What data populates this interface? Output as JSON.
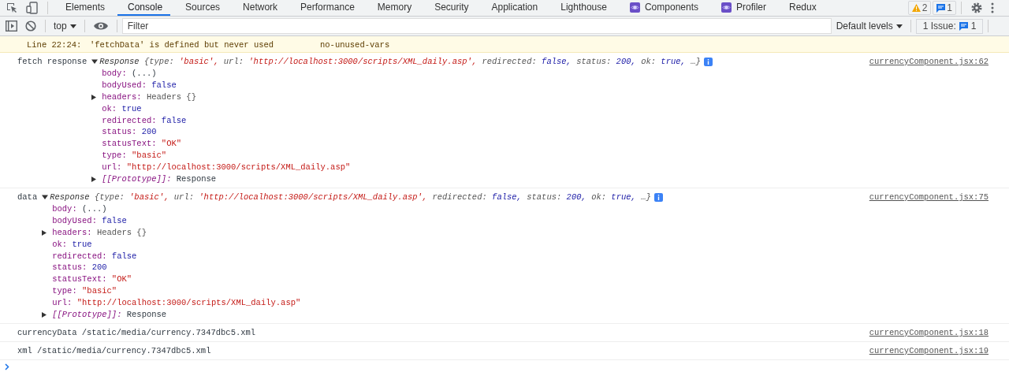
{
  "tabs": [
    {
      "label": "Elements",
      "selected": false,
      "kind": "plain"
    },
    {
      "label": "Console",
      "selected": true,
      "kind": "plain"
    },
    {
      "label": "Sources",
      "selected": false,
      "kind": "plain"
    },
    {
      "label": "Network",
      "selected": false,
      "kind": "plain"
    },
    {
      "label": "Performance",
      "selected": false,
      "kind": "plain"
    },
    {
      "label": "Memory",
      "selected": false,
      "kind": "plain"
    },
    {
      "label": "Security",
      "selected": false,
      "kind": "plain"
    },
    {
      "label": "Application",
      "selected": false,
      "kind": "plain"
    },
    {
      "label": "Lighthouse",
      "selected": false,
      "kind": "plain"
    },
    {
      "label": "Components",
      "selected": false,
      "kind": "react"
    },
    {
      "label": "Profiler",
      "selected": false,
      "kind": "react"
    },
    {
      "label": "Redux",
      "selected": false,
      "kind": "plain"
    }
  ],
  "counters": {
    "warnings": "2",
    "messages": "1"
  },
  "toolbar": {
    "context": "top",
    "filter_placeholder": "Filter",
    "levels": "Default levels",
    "issues_label": "1 Issue:",
    "issues_count": "1"
  },
  "warnings": [
    {
      "location": "Line 22:24:",
      "message": "'fetchData' is defined but never used",
      "rule": "no-unused-vars"
    }
  ],
  "messages": [
    {
      "label": "fetch response",
      "kind": "object",
      "expanded": true,
      "class_name": "Response",
      "open": "{",
      "close": "…}",
      "source": "currencyComponent.jsx:62",
      "preview": [
        {
          "key": "type:",
          "value": "'basic',",
          "kind": "string"
        },
        {
          "key": "url:",
          "value": "'http://localhost:3000/scripts/XML_daily.asp',",
          "kind": "string"
        },
        {
          "key": "redirected:",
          "value": "false,",
          "kind": "keyword"
        },
        {
          "key": "status:",
          "value": "200,",
          "kind": "keyword"
        },
        {
          "key": "ok:",
          "value": "true,",
          "kind": "keyword"
        }
      ],
      "properties": [
        {
          "name": "body:",
          "value": "(...)",
          "kind": "plain",
          "internal": false,
          "expandable": false
        },
        {
          "name": "bodyUsed:",
          "value": "false",
          "kind": "keyword",
          "internal": false,
          "expandable": false
        },
        {
          "name": "headers:",
          "value": "Headers {}",
          "kind": "object",
          "internal": false,
          "expandable": true
        },
        {
          "name": "ok:",
          "value": "true",
          "kind": "keyword",
          "internal": false,
          "expandable": false
        },
        {
          "name": "redirected:",
          "value": "false",
          "kind": "keyword",
          "internal": false,
          "expandable": false
        },
        {
          "name": "status:",
          "value": "200",
          "kind": "keyword",
          "internal": false,
          "expandable": false
        },
        {
          "name": "statusText:",
          "value": "\"OK\"",
          "kind": "string",
          "internal": false,
          "expandable": false
        },
        {
          "name": "type:",
          "value": "\"basic\"",
          "kind": "string",
          "internal": false,
          "expandable": false
        },
        {
          "name": "url:",
          "value": "\"http://localhost:3000/scripts/XML_daily.asp\"",
          "kind": "string",
          "internal": false,
          "expandable": false
        },
        {
          "name": "[[Prototype]]:",
          "value": "Response",
          "kind": "plain",
          "internal": true,
          "expandable": true
        }
      ]
    },
    {
      "label": "data",
      "kind": "object",
      "expanded": true,
      "class_name": "Response",
      "open": "{",
      "close": "…}",
      "source": "currencyComponent.jsx:75",
      "preview": [
        {
          "key": "type:",
          "value": "'basic',",
          "kind": "string"
        },
        {
          "key": "url:",
          "value": "'http://localhost:3000/scripts/XML_daily.asp',",
          "kind": "string"
        },
        {
          "key": "redirected:",
          "value": "false,",
          "kind": "keyword"
        },
        {
          "key": "status:",
          "value": "200,",
          "kind": "keyword"
        },
        {
          "key": "ok:",
          "value": "true,",
          "kind": "keyword"
        }
      ],
      "properties": [
        {
          "name": "body:",
          "value": "(...)",
          "kind": "plain",
          "internal": false,
          "expandable": false
        },
        {
          "name": "bodyUsed:",
          "value": "false",
          "kind": "keyword",
          "internal": false,
          "expandable": false
        },
        {
          "name": "headers:",
          "value": "Headers {}",
          "kind": "object",
          "internal": false,
          "expandable": true
        },
        {
          "name": "ok:",
          "value": "true",
          "kind": "keyword",
          "internal": false,
          "expandable": false
        },
        {
          "name": "redirected:",
          "value": "false",
          "kind": "keyword",
          "internal": false,
          "expandable": false
        },
        {
          "name": "status:",
          "value": "200",
          "kind": "keyword",
          "internal": false,
          "expandable": false
        },
        {
          "name": "statusText:",
          "value": "\"OK\"",
          "kind": "string",
          "internal": false,
          "expandable": false
        },
        {
          "name": "type:",
          "value": "\"basic\"",
          "kind": "string",
          "internal": false,
          "expandable": false
        },
        {
          "name": "url:",
          "value": "\"http://localhost:3000/scripts/XML_daily.asp\"",
          "kind": "string",
          "internal": false,
          "expandable": false
        },
        {
          "name": "[[Prototype]]:",
          "value": "Response",
          "kind": "plain",
          "internal": true,
          "expandable": true
        }
      ]
    },
    {
      "label": "currencyData",
      "kind": "text",
      "text": "/static/media/currency.7347dbc5.xml",
      "source": "currencyComponent.jsx:18"
    },
    {
      "label": "xml",
      "kind": "text",
      "text": "/static/media/currency.7347dbc5.xml",
      "source": "currencyComponent.jsx:19"
    }
  ]
}
